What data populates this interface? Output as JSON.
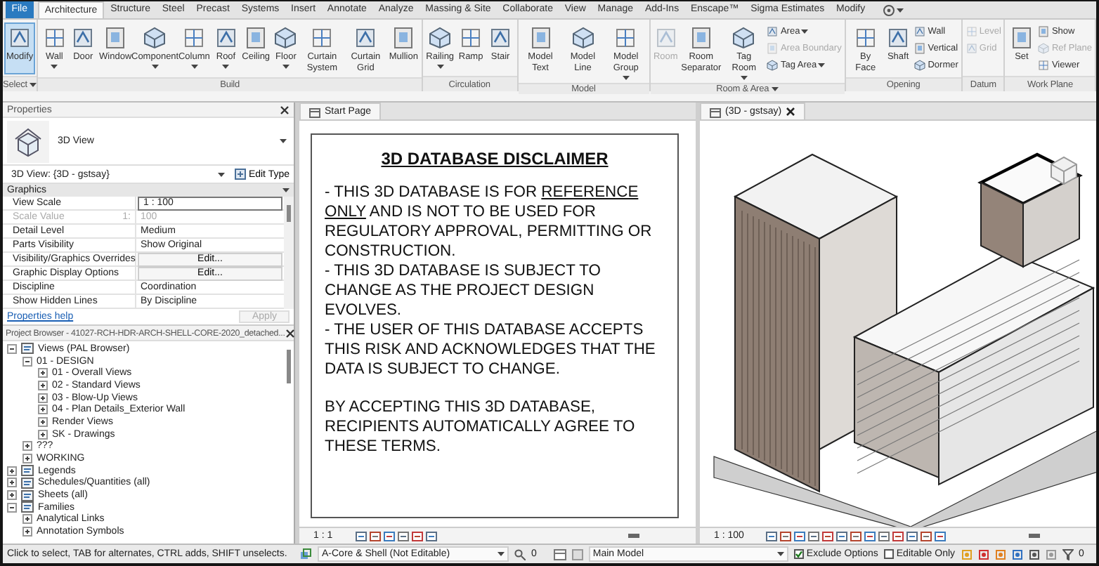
{
  "ribbon_tabs": [
    {
      "label": "File",
      "kind": "file",
      "selected": false
    },
    {
      "label": "Architecture",
      "kind": "tab",
      "selected": true
    },
    {
      "label": "Structure",
      "kind": "tab",
      "selected": false
    },
    {
      "label": "Steel",
      "kind": "tab",
      "selected": false
    },
    {
      "label": "Precast",
      "kind": "tab",
      "selected": false
    },
    {
      "label": "Systems",
      "kind": "tab",
      "selected": false
    },
    {
      "label": "Insert",
      "kind": "tab",
      "selected": false
    },
    {
      "label": "Annotate",
      "kind": "tab",
      "selected": false
    },
    {
      "label": "Analyze",
      "kind": "tab",
      "selected": false
    },
    {
      "label": "Massing & Site",
      "kind": "tab",
      "selected": false
    },
    {
      "label": "Collaborate",
      "kind": "tab",
      "selected": false
    },
    {
      "label": "View",
      "kind": "tab",
      "selected": false
    },
    {
      "label": "Manage",
      "kind": "tab",
      "selected": false
    },
    {
      "label": "Add-Ins",
      "kind": "tab",
      "selected": false
    },
    {
      "label": "Enscape™",
      "kind": "tab",
      "selected": false
    },
    {
      "label": "Sigma Estimates",
      "kind": "tab",
      "selected": false
    },
    {
      "label": "Modify",
      "kind": "tab",
      "selected": false
    }
  ],
  "ribbon_panels": [
    {
      "label": "Select",
      "menu": true,
      "tools": [
        {
          "label": "Modify",
          "kind": "large",
          "selected": true,
          "disabled": false,
          "dropdown": false
        }
      ]
    },
    {
      "label": "Build",
      "menu": false,
      "tools": [
        {
          "label": "Wall",
          "kind": "large",
          "selected": false,
          "disabled": false,
          "dropdown": true
        },
        {
          "label": "Door",
          "kind": "large",
          "selected": false,
          "disabled": false,
          "dropdown": false
        },
        {
          "label": "Window",
          "kind": "large",
          "selected": false,
          "disabled": false,
          "dropdown": false
        },
        {
          "label": "Component",
          "kind": "large",
          "selected": false,
          "disabled": false,
          "dropdown": true
        },
        {
          "label": "Column",
          "kind": "large",
          "selected": false,
          "disabled": false,
          "dropdown": true
        },
        {
          "label": "Roof",
          "kind": "large",
          "selected": false,
          "disabled": false,
          "dropdown": true
        },
        {
          "label": "Ceiling",
          "kind": "large",
          "selected": false,
          "disabled": false,
          "dropdown": false
        },
        {
          "label": "Floor",
          "kind": "large",
          "selected": false,
          "disabled": false,
          "dropdown": true
        },
        {
          "label": "Curtain System",
          "kind": "large",
          "selected": false,
          "disabled": false,
          "dropdown": false
        },
        {
          "label": "Curtain Grid",
          "kind": "large",
          "selected": false,
          "disabled": false,
          "dropdown": false
        },
        {
          "label": "Mullion",
          "kind": "large",
          "selected": false,
          "disabled": false,
          "dropdown": false
        }
      ]
    },
    {
      "label": "Circulation",
      "menu": false,
      "tools": [
        {
          "label": "Railing",
          "kind": "large",
          "selected": false,
          "disabled": false,
          "dropdown": true
        },
        {
          "label": "Ramp",
          "kind": "large",
          "selected": false,
          "disabled": false,
          "dropdown": false
        },
        {
          "label": "Stair",
          "kind": "large",
          "selected": false,
          "disabled": false,
          "dropdown": false
        }
      ]
    },
    {
      "label": "Model",
      "menu": false,
      "tools": [
        {
          "label": "Model Text",
          "kind": "large",
          "selected": false,
          "disabled": false,
          "dropdown": false
        },
        {
          "label": "Model Line",
          "kind": "large",
          "selected": false,
          "disabled": false,
          "dropdown": false
        },
        {
          "label": "Model Group",
          "kind": "large",
          "selected": false,
          "disabled": false,
          "dropdown": true
        }
      ]
    },
    {
      "label": "Room & Area",
      "menu": true,
      "tools": [
        {
          "label": "Room",
          "kind": "large",
          "selected": false,
          "disabled": true,
          "dropdown": false
        },
        {
          "label": "Room Separator",
          "kind": "large",
          "selected": false,
          "disabled": false,
          "dropdown": false
        },
        {
          "label": "Tag Room",
          "kind": "large",
          "selected": false,
          "disabled": false,
          "dropdown": true
        },
        {
          "label": "Area",
          "kind": "small",
          "selected": false,
          "disabled": false,
          "dropdown": true
        },
        {
          "label": "Area Boundary",
          "kind": "small",
          "selected": false,
          "disabled": true,
          "dropdown": false
        },
        {
          "label": "Tag Area",
          "kind": "small",
          "selected": false,
          "disabled": false,
          "dropdown": true
        }
      ]
    },
    {
      "label": "Opening",
      "menu": false,
      "tools": [
        {
          "label": "By Face",
          "kind": "large",
          "selected": false,
          "disabled": false,
          "dropdown": false
        },
        {
          "label": "Shaft",
          "kind": "large",
          "selected": false,
          "disabled": false,
          "dropdown": false
        },
        {
          "label": "Wall",
          "kind": "small",
          "selected": false,
          "disabled": false,
          "dropdown": false
        },
        {
          "label": "Vertical",
          "kind": "small",
          "selected": false,
          "disabled": false,
          "dropdown": false
        },
        {
          "label": "Dormer",
          "kind": "small",
          "selected": false,
          "disabled": false,
          "dropdown": false
        }
      ]
    },
    {
      "label": "Datum",
      "menu": false,
      "tools": [
        {
          "label": "Level",
          "kind": "small",
          "selected": false,
          "disabled": true,
          "dropdown": false
        },
        {
          "label": "Grid",
          "kind": "small",
          "selected": false,
          "disabled": true,
          "dropdown": false
        }
      ]
    },
    {
      "label": "Work Plane",
      "menu": false,
      "tools": [
        {
          "label": "Set",
          "kind": "large",
          "selected": false,
          "disabled": false,
          "dropdown": false
        },
        {
          "label": "Show",
          "kind": "small",
          "selected": false,
          "disabled": false,
          "dropdown": false
        },
        {
          "label": "Ref Plane",
          "kind": "small",
          "selected": false,
          "disabled": true,
          "dropdown": false
        },
        {
          "label": "Viewer",
          "kind": "small",
          "selected": false,
          "disabled": false,
          "dropdown": false
        }
      ]
    }
  ],
  "properties": {
    "title": "Properties",
    "type_name": "3D View",
    "instance": "3D View: {3D - gstsay}",
    "edit_type": "Edit Type",
    "section": "Graphics",
    "rows": [
      {
        "name": "View Scale",
        "value": "1 : 100",
        "kind": "field",
        "disabled": false
      },
      {
        "name": "Scale Value",
        "prefix": "1:",
        "value": "100",
        "kind": "text",
        "disabled": true
      },
      {
        "name": "Detail Level",
        "value": "Medium",
        "kind": "text",
        "disabled": false
      },
      {
        "name": "Parts Visibility",
        "value": "Show Original",
        "kind": "text",
        "disabled": false
      },
      {
        "name": "Visibility/Graphics Overrides",
        "value": "Edit...",
        "kind": "button",
        "disabled": false
      },
      {
        "name": "Graphic Display Options",
        "value": "Edit...",
        "kind": "button",
        "disabled": false
      },
      {
        "name": "Discipline",
        "value": "Coordination",
        "kind": "text",
        "disabled": false
      },
      {
        "name": "Show Hidden Lines",
        "value": "By Discipline",
        "kind": "text",
        "disabled": false
      }
    ],
    "help": "Properties help",
    "apply": "Apply",
    "apply_disabled": true
  },
  "project_browser": {
    "title": "Project Browser - 41027-RCH-HDR-ARCH-SHELL-CORE-2020_detached...",
    "tree": [
      {
        "label": "Views (PAL Browser)",
        "expanded": true,
        "children": [
          {
            "label": "01 - DESIGN",
            "expanded": true,
            "children": [
              {
                "label": "01 - Overall Views",
                "expanded": false
              },
              {
                "label": "02 - Standard Views",
                "expanded": false
              },
              {
                "label": "03 - Blow-Up Views",
                "expanded": false
              },
              {
                "label": "04 - Plan Details_Exterior Wall",
                "expanded": false
              },
              {
                "label": "Render Views",
                "expanded": false
              },
              {
                "label": "SK - Drawings",
                "expanded": false
              }
            ]
          },
          {
            "label": "???",
            "expanded": false
          },
          {
            "label": "WORKING",
            "expanded": false
          }
        ]
      },
      {
        "label": "Legends",
        "expanded": false
      },
      {
        "label": "Schedules/Quantities (all)",
        "expanded": false
      },
      {
        "label": "Sheets (all)",
        "expanded": false
      },
      {
        "label": "Families",
        "expanded": true,
        "children": [
          {
            "label": "Analytical Links",
            "expanded": false
          },
          {
            "label": "Annotation Symbols",
            "expanded": false
          }
        ]
      }
    ]
  },
  "start_page": {
    "tab": "Start Page",
    "scale": "1 : 1",
    "disclaimer": {
      "title": "3D DATABASE DISCLAIMER",
      "paragraphs": [
        [
          {
            "text": "- THIS 3D DATABASE IS FOR ",
            "underlined": false
          },
          {
            "text": "REFERENCE ONLY",
            "underlined": true
          },
          {
            "text": " AND IS NOT TO BE USED FOR REGULATORY APPROVAL, PERMITTING OR CONSTRUCTION.",
            "underlined": false
          }
        ],
        [
          {
            "text": "- THIS 3D DATABASE IS SUBJECT TO CHANGE AS THE PROJECT DESIGN EVOLVES.",
            "underlined": false
          }
        ],
        [
          {
            "text": "- THE USER OF THIS DATABASE ACCEPTS THIS RISK AND ACKNOWLEDGES THAT THE DATA IS SUBJECT TO CHANGE.",
            "underlined": false
          }
        ],
        [
          {
            "text": "BY ACCEPTING THIS 3D DATABASE, RECIPIENTS AUTOMATICALLY AGREE TO THESE TERMS.",
            "underlined": false
          }
        ]
      ]
    }
  },
  "view_3d": {
    "tab": "(3D - gstsay)",
    "scale": "1 : 100"
  },
  "status_bar": {
    "hint": "Click to select, TAB for alternates, CTRL adds, SHIFT unselects.",
    "workset": "A-Core & Shell (Not Editable)",
    "selection_count": "0",
    "design_option": "Main Model",
    "checkboxes": [
      {
        "label": "Exclude Options",
        "checked": true
      },
      {
        "label": "Editable Only",
        "checked": false
      }
    ],
    "filter_count": "0"
  }
}
